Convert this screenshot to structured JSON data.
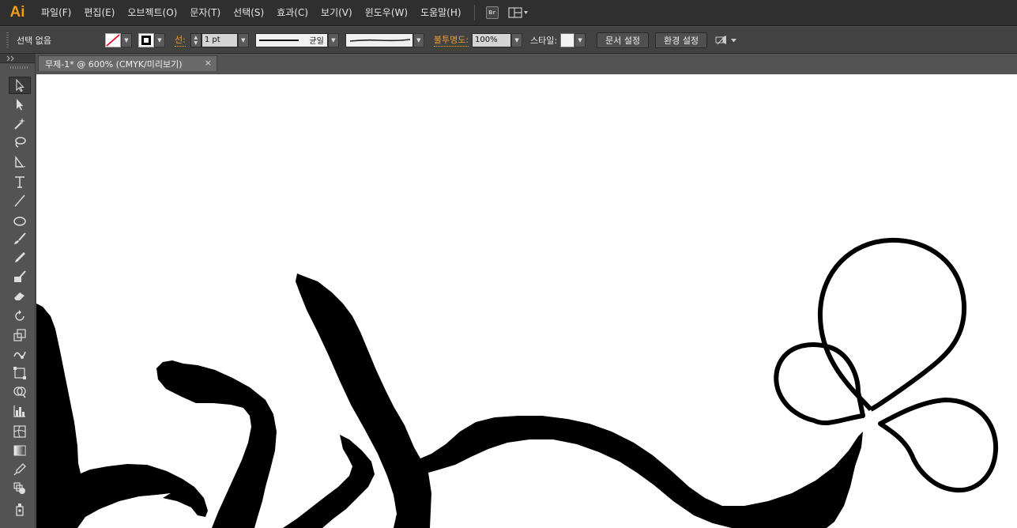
{
  "app": {
    "logo": "Ai"
  },
  "menu": {
    "items": [
      "파일(F)",
      "편집(E)",
      "오브젝트(O)",
      "문자(T)",
      "선택(S)",
      "효과(C)",
      "보기(V)",
      "윈도우(W)",
      "도움말(H)"
    ],
    "bridge_label": "Br"
  },
  "control": {
    "selection_status": "선택 없음",
    "stroke_label": "선:",
    "stroke_weight": "1 pt",
    "profile_label": "균일",
    "opacity_label": "불투명도:",
    "opacity_value": "100%",
    "style_label": "스타일:",
    "doc_setup_button": "문서 설정",
    "preferences_button": "환경 설정"
  },
  "document": {
    "tab_title": "무제-1* @ 600% (CMYK/미리보기)",
    "close_glyph": "×"
  },
  "colors": {
    "accent": "#f09b2c",
    "menubar_bg": "#2f2f2f",
    "panel_bg": "#535353",
    "canvas_bg": "#ffffff",
    "ink": "#000000"
  },
  "tools": [
    "selection-tool",
    "direct-selection-tool",
    "magic-wand-tool",
    "lasso-tool",
    "pen-tool",
    "type-tool",
    "line-segment-tool",
    "ellipse-tool",
    "paintbrush-tool",
    "pencil-tool",
    "blob-brush-tool",
    "eraser-tool",
    "rotate-tool",
    "scale-tool",
    "warp-tool",
    "free-transform-tool",
    "shape-builder-tool",
    "graph-tool",
    "mesh-tool",
    "gradient-tool",
    "eyedropper-tool",
    "blend-tool",
    "symbol-sprayer-tool"
  ]
}
